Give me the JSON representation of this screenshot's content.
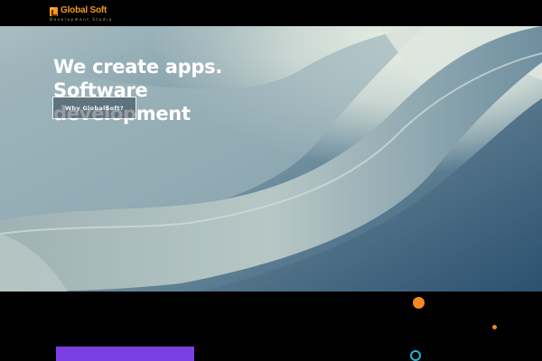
{
  "header": {
    "logo_global": "Global",
    "logo_soft": "Soft",
    "logo_tagline": "Development Studio",
    "logo_icon": "logo-mark-icon"
  },
  "hero": {
    "title_line1": "We create apps.",
    "title_line2": "Software",
    "title_line3": "development",
    "button_label": "Why GlobalSoft?"
  },
  "colors": {
    "accent_orange": "#f5891f",
    "accent_purple": "#7b3fe4",
    "accent_teal": "#1fb8d6",
    "background": "#000000",
    "text": "#ffffff"
  }
}
